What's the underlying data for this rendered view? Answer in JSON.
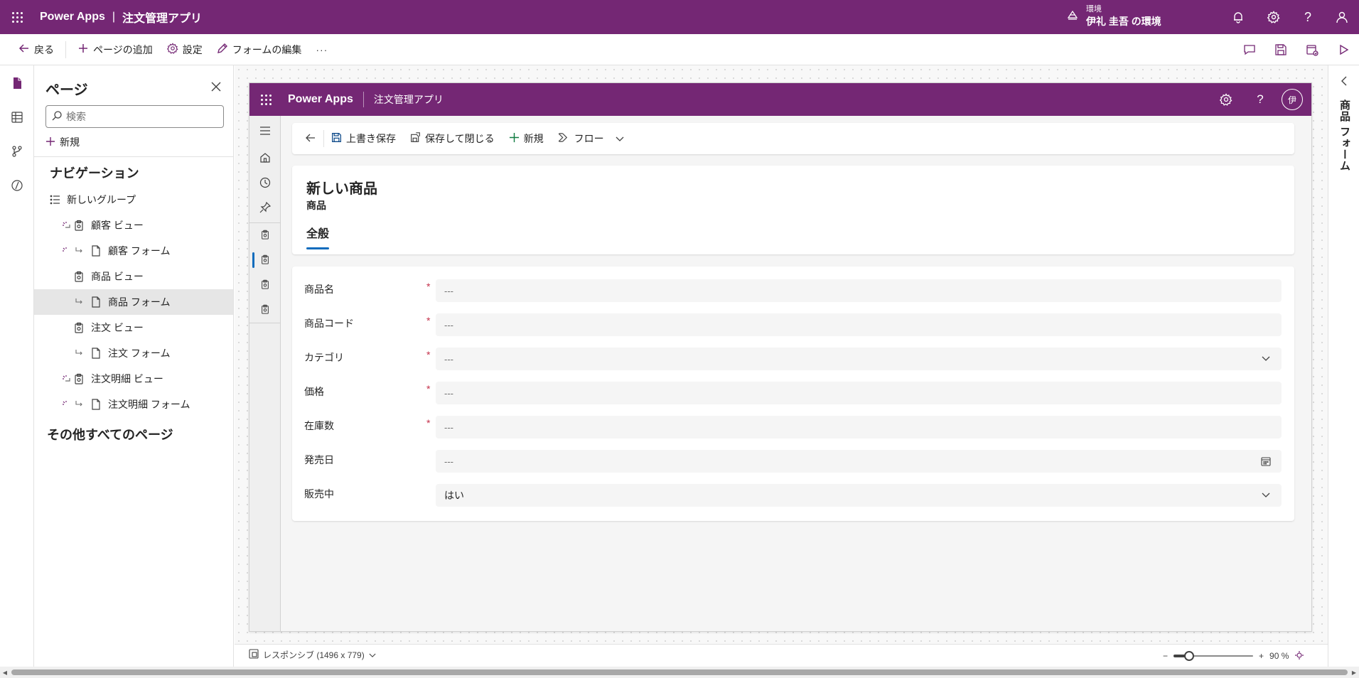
{
  "topbar": {
    "app_name": "Power Apps",
    "separator": "|",
    "app_title": "注文管理アプリ",
    "env_label": "環境",
    "env_name": "伊礼 圭吾 の環境"
  },
  "command_bar": {
    "back": "戻る",
    "add_page": "ページの追加",
    "settings": "設定",
    "edit_form": "フォームの編集",
    "more": "···"
  },
  "pages_pane": {
    "title": "ページ",
    "search_placeholder": "検索",
    "search_value": "",
    "new_label": "新規",
    "navigation_heading": "ナビゲーション",
    "items": [
      {
        "label": "新しいグループ",
        "type": "group",
        "warning": false
      },
      {
        "label": "顧客 ビュー",
        "type": "view",
        "warning": true
      },
      {
        "label": "顧客 フォーム",
        "type": "form",
        "warning": true
      },
      {
        "label": "商品 ビュー",
        "type": "view",
        "warning": false
      },
      {
        "label": "商品 フォーム",
        "type": "form",
        "warning": false,
        "selected": true
      },
      {
        "label": "注文 ビュー",
        "type": "view",
        "warning": false
      },
      {
        "label": "注文 フォーム",
        "type": "form",
        "warning": false
      },
      {
        "label": "注文明細 ビュー",
        "type": "view",
        "warning": true
      },
      {
        "label": "注文明細 フォーム",
        "type": "form",
        "warning": true
      }
    ],
    "other_pages_heading": "その他すべてのページ"
  },
  "preview": {
    "app_name": "Power Apps",
    "app_title": "注文管理アプリ",
    "avatar_initial": "伊",
    "form_commands": {
      "save": "上書き保存",
      "save_close": "保存して閉じる",
      "new": "新規",
      "flow": "フロー"
    },
    "form": {
      "title": "新しい商品",
      "entity": "商品",
      "tab": "全般",
      "fields": [
        {
          "label": "商品名",
          "required": true,
          "value": "---",
          "control": "text"
        },
        {
          "label": "商品コード",
          "required": true,
          "value": "---",
          "control": "text"
        },
        {
          "label": "カテゴリ",
          "required": true,
          "value": "---",
          "control": "dropdown"
        },
        {
          "label": "価格",
          "required": true,
          "value": "---",
          "control": "text"
        },
        {
          "label": "在庫数",
          "required": true,
          "value": "---",
          "control": "text"
        },
        {
          "label": "発売日",
          "required": false,
          "value": "---",
          "control": "date"
        },
        {
          "label": "販売中",
          "required": false,
          "value": "はい",
          "control": "dropdown"
        }
      ],
      "required_marker": "*"
    }
  },
  "properties_strip": {
    "title": "商品 フォーム"
  },
  "status_bar": {
    "layout": "レスポンシブ (1496 x 779)",
    "zoom_minus": "−",
    "zoom_plus": "+",
    "zoom_percent": "90 %",
    "zoom_level": 0.2
  },
  "colors": {
    "brand": "#742774",
    "accent": "#0f6cbd",
    "required": "#c4314b"
  }
}
